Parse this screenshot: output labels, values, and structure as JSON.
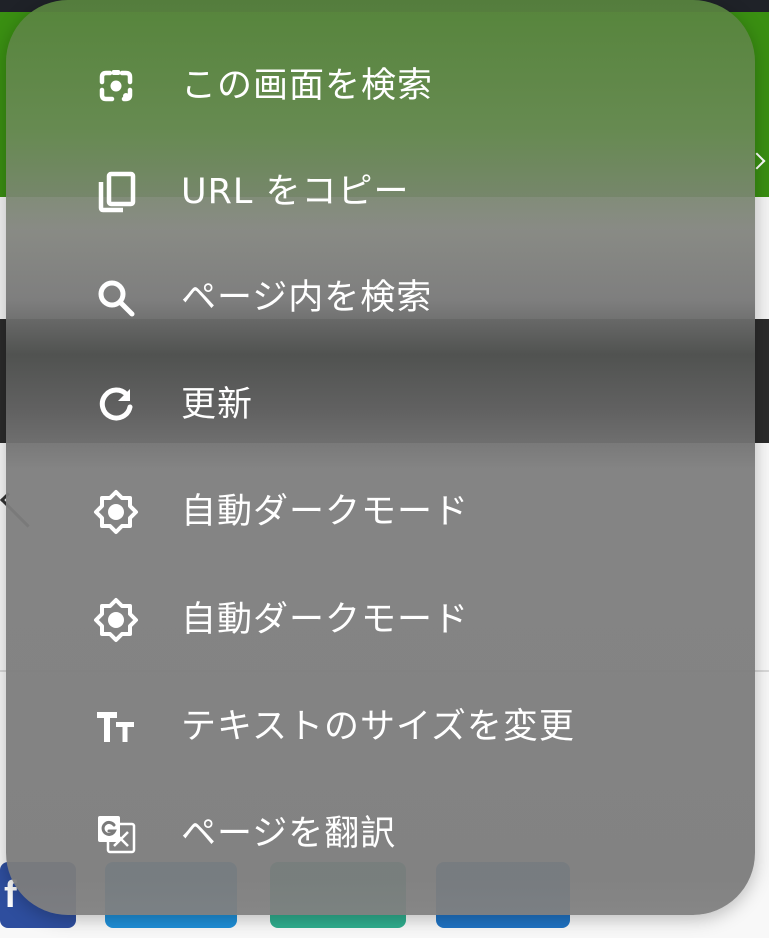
{
  "background": {
    "share_buttons": [
      {
        "name": "facebook",
        "label": "f",
        "color": "#2e4e9e"
      },
      {
        "name": "twitter",
        "color": "#1e8fd8"
      },
      {
        "name": "line",
        "color": "#2fae8e"
      },
      {
        "name": "hatena",
        "color": "#1f73c4"
      }
    ]
  },
  "menu": {
    "items": [
      {
        "id": "search-screen",
        "icon": "lens-camera-icon",
        "label": "この画面を検索"
      },
      {
        "id": "copy-url",
        "icon": "copy-icon",
        "label": "URL をコピー"
      },
      {
        "id": "find-in-page",
        "icon": "search-icon",
        "label": "ページ内を検索"
      },
      {
        "id": "reload",
        "icon": "refresh-icon",
        "label": "更新"
      },
      {
        "id": "auto-dark-mode-1",
        "icon": "brightness-icon",
        "label": "自動ダークモード"
      },
      {
        "id": "auto-dark-mode-2",
        "icon": "brightness-icon",
        "label": "自動ダークモード"
      },
      {
        "id": "text-size",
        "icon": "text-size-icon",
        "label": "テキストのサイズを変更"
      },
      {
        "id": "translate",
        "icon": "translate-icon",
        "label": "ページを翻訳"
      }
    ]
  },
  "colors": {
    "menu_text": "#ffffff",
    "page_green": "#3a8f12"
  }
}
